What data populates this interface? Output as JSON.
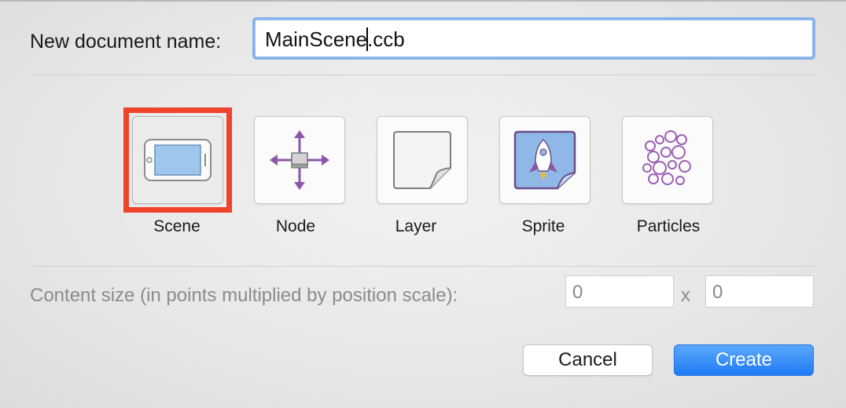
{
  "dialog": {
    "name_label": "New document name:",
    "name_value_before_caret": "MainScene",
    "name_value_after_caret": ".ccb",
    "types": [
      {
        "label": "Scene",
        "icon": "scene-icon",
        "selected": true
      },
      {
        "label": "Node",
        "icon": "node-icon",
        "selected": false
      },
      {
        "label": "Layer",
        "icon": "layer-icon",
        "selected": false
      },
      {
        "label": "Sprite",
        "icon": "sprite-icon",
        "selected": false
      },
      {
        "label": "Particles",
        "icon": "particles-icon",
        "selected": false
      }
    ],
    "content_size_label": "Content size (in points multiplied by position scale):",
    "width_value": "0",
    "times_symbol": "x",
    "height_value": "0",
    "cancel_label": "Cancel",
    "create_label": "Create"
  },
  "colors": {
    "selection": "#f0432c",
    "accent": "#1f7af5",
    "icon_purple": "#8d56a8"
  }
}
